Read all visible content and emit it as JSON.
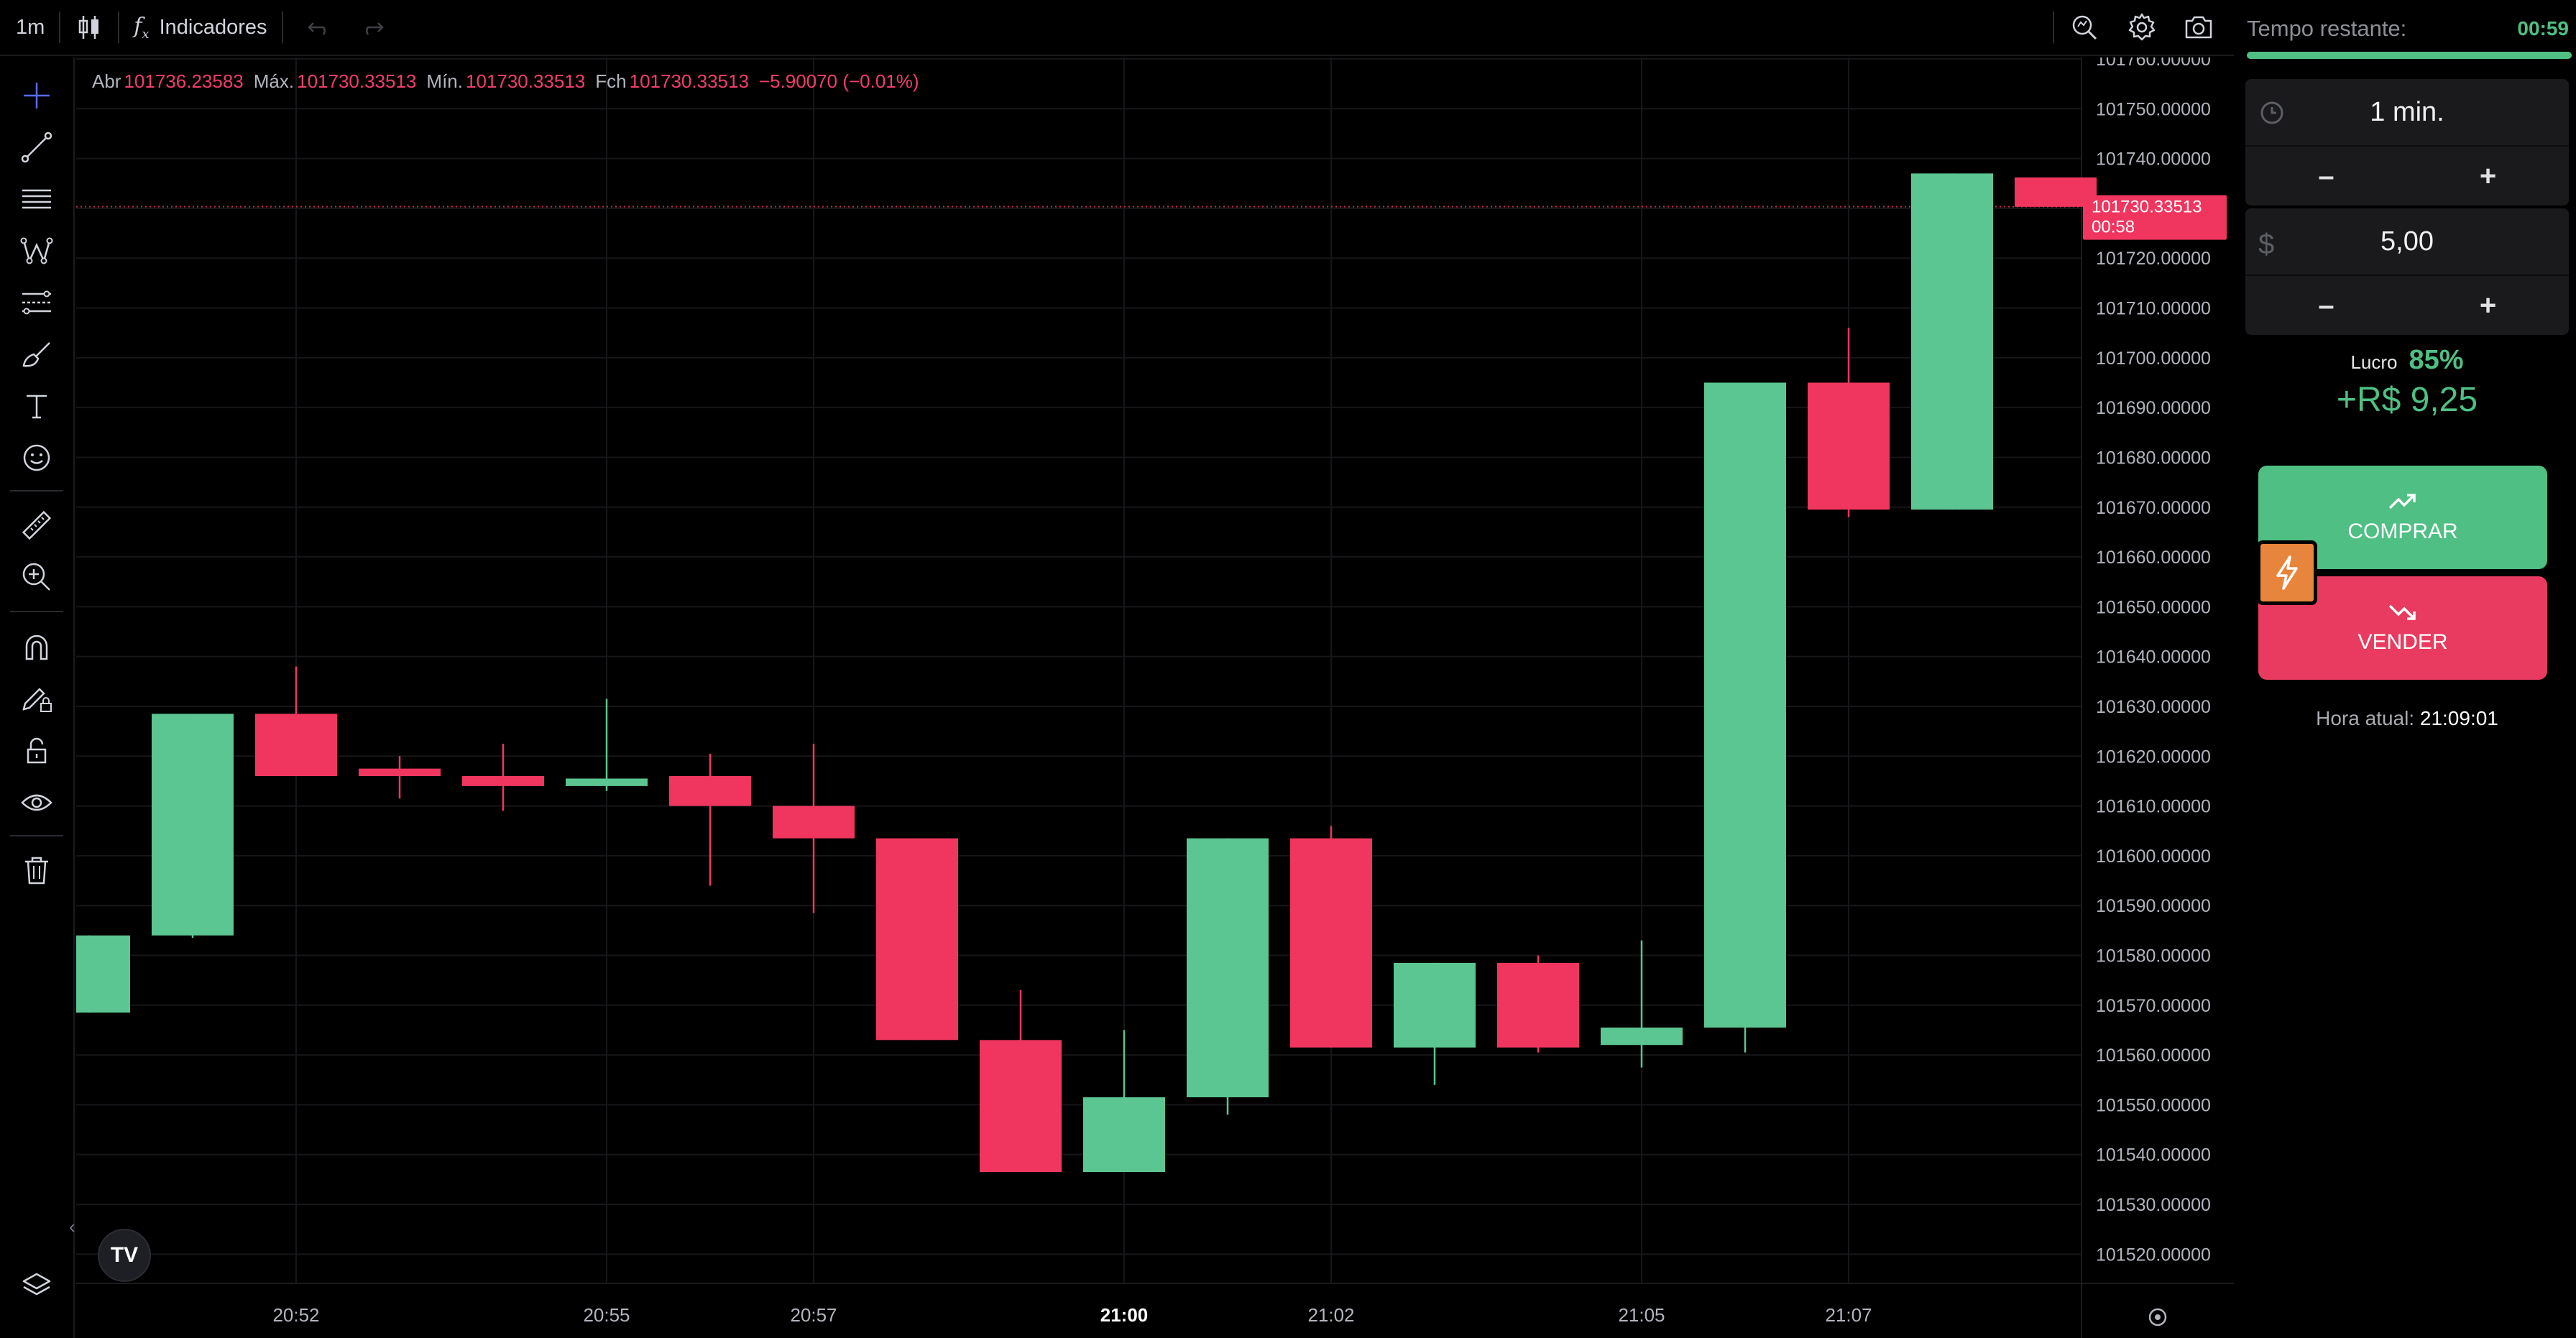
{
  "toolbar": {
    "timeframe": "1m",
    "indicators_label": "Indicadores"
  },
  "ohlc": {
    "open_label": "Abr",
    "open": "101736.23583",
    "high_label": "Máx.",
    "high": "101730.33513",
    "low_label": "Mín.",
    "low": "101730.33513",
    "close_label": "Fch",
    "close": "101730.33513",
    "change": "−5.90070 (−0.01%)"
  },
  "chart_data": {
    "type": "candlestick",
    "ylim": [
      101515,
      101760
    ],
    "ylabels": [
      "101760.00000",
      "101750.00000",
      "101740.00000",
      "101730.00000",
      "101720.00000",
      "101710.00000",
      "101700.00000",
      "101690.00000",
      "101680.00000",
      "101670.00000",
      "101660.00000",
      "101650.00000",
      "101640.00000",
      "101630.00000",
      "101620.00000",
      "101610.00000",
      "101600.00000",
      "101590.00000",
      "101580.00000",
      "101570.00000",
      "101560.00000",
      "101550.00000",
      "101540.00000",
      "101530.00000",
      "101520.00000"
    ],
    "xticks": [
      {
        "label": "20:52",
        "index": 2,
        "bold": false
      },
      {
        "label": "20:55",
        "index": 5,
        "bold": false
      },
      {
        "label": "20:57",
        "index": 7,
        "bold": false
      },
      {
        "label": "21:00",
        "index": 10,
        "bold": true
      },
      {
        "label": "21:02",
        "index": 12,
        "bold": false
      },
      {
        "label": "21:05",
        "index": 15,
        "bold": false
      },
      {
        "label": "21:07",
        "index": 17,
        "bold": false
      }
    ],
    "candles": [
      {
        "o": 101568.5,
        "h": 101584.0,
        "l": 101568.5,
        "c": 101584.0
      },
      {
        "o": 101584.0,
        "h": 101628.5,
        "l": 101583.5,
        "c": 101628.5
      },
      {
        "o": 101628.5,
        "h": 101638.0,
        "l": 101616.0,
        "c": 101616.0
      },
      {
        "o": 101617.5,
        "h": 101620.0,
        "l": 101611.5,
        "c": 101616.0
      },
      {
        "o": 101616.0,
        "h": 101622.5,
        "l": 101609.0,
        "c": 101614.0
      },
      {
        "o": 101614.0,
        "h": 101631.5,
        "l": 101613.0,
        "c": 101615.5
      },
      {
        "o": 101616.0,
        "h": 101620.5,
        "l": 101594.0,
        "c": 101610.0
      },
      {
        "o": 101610.0,
        "h": 101622.5,
        "l": 101588.5,
        "c": 101603.5
      },
      {
        "o": 101603.5,
        "h": 101603.5,
        "l": 101563.0,
        "c": 101563.0
      },
      {
        "o": 101563.0,
        "h": 101573.0,
        "l": 101536.5,
        "c": 101536.5
      },
      {
        "o": 101536.5,
        "h": 101565.0,
        "l": 101536.5,
        "c": 101551.5
      },
      {
        "o": 101551.5,
        "h": 101603.5,
        "l": 101548.0,
        "c": 101603.5
      },
      {
        "o": 101603.5,
        "h": 101606.0,
        "l": 101561.5,
        "c": 101561.5
      },
      {
        "o": 101561.5,
        "h": 101578.5,
        "l": 101554.0,
        "c": 101578.5
      },
      {
        "o": 101578.5,
        "h": 101580.0,
        "l": 101560.5,
        "c": 101561.5
      },
      {
        "o": 101562.0,
        "h": 101583.0,
        "l": 101557.5,
        "c": 101565.5
      },
      {
        "o": 101565.5,
        "h": 101695.0,
        "l": 101560.5,
        "c": 101695.0
      },
      {
        "o": 101695.0,
        "h": 101706.0,
        "l": 101668.0,
        "c": 101669.5
      },
      {
        "o": 101669.5,
        "h": 101737.0,
        "l": 101669.5,
        "c": 101737.0
      },
      {
        "o": 101736.2,
        "h": 101736.2,
        "l": 101730.3,
        "c": 101730.3
      }
    ],
    "current_price": "101730.33513",
    "countdown": "00:58",
    "colors": {
      "up": "#5bc691",
      "down": "#f0365f",
      "grid": "#16161a",
      "bg": "#000000"
    }
  },
  "panel": {
    "timer_label": "Tempo restante:",
    "timer_value": "00:59",
    "timer_progress": 1.0,
    "duration_value": "1 min.",
    "amount_value": "5,00",
    "minus": "–",
    "plus": "+",
    "profit_label": "Lucro",
    "profit_pct": "85%",
    "profit_amount": "+R$ 9,25",
    "buy_label": "COMPRAR",
    "sell_label": "VENDER",
    "clock_label": "Hora atual:",
    "clock_value": "21:09:01",
    "colors": {
      "buy": "#4fbf84",
      "sell": "#e83b5f",
      "flash": "#e8853c"
    }
  },
  "logo_text": "TV"
}
